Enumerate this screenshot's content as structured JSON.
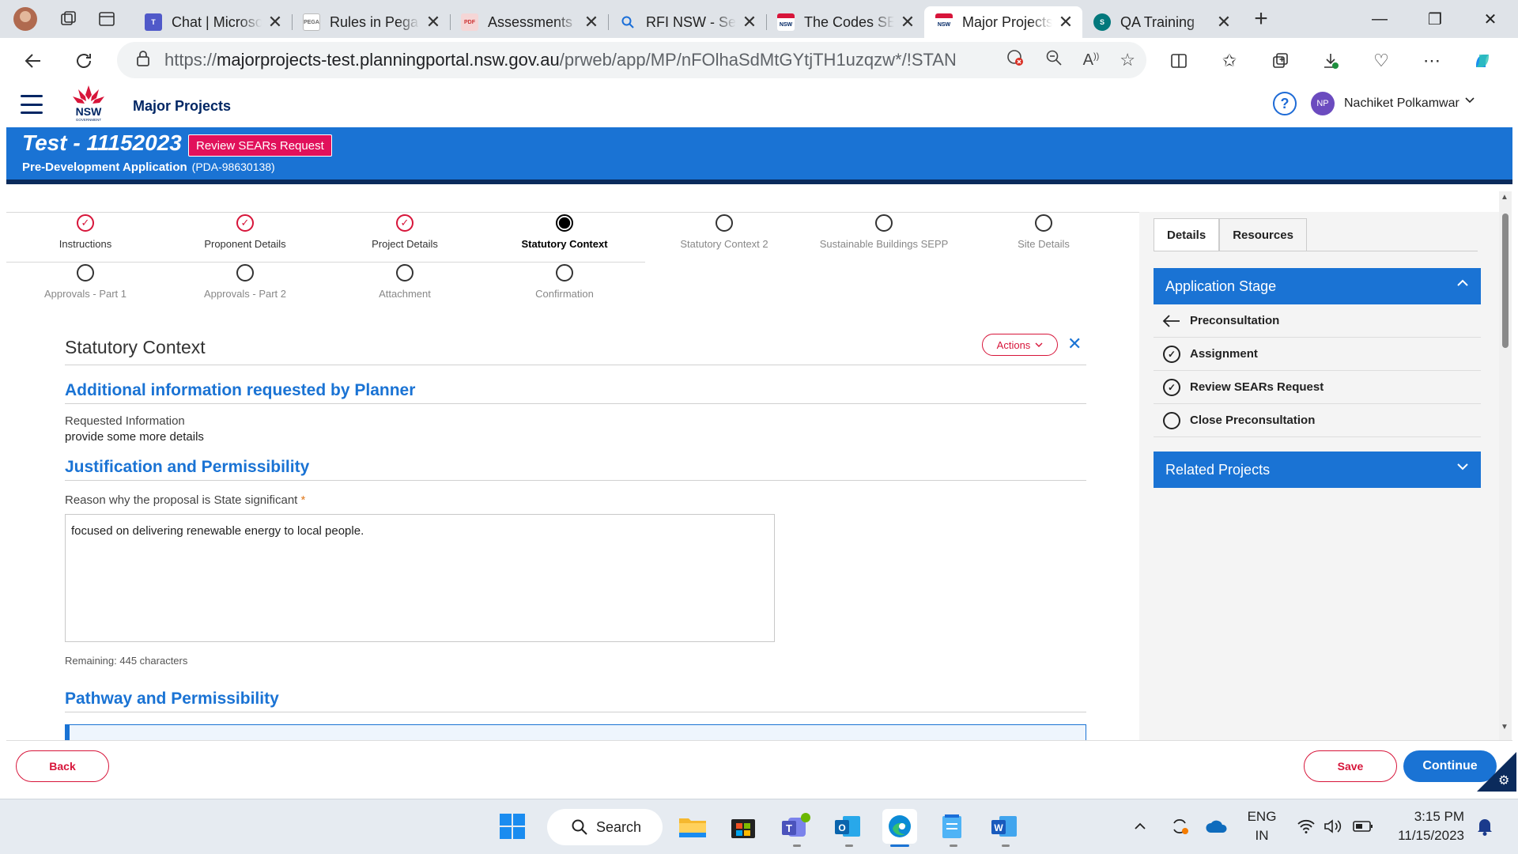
{
  "browser": {
    "tabs": [
      {
        "title": "Chat | Microsoft Teams",
        "icon": "teams-icon",
        "active": false
      },
      {
        "title": "Rules in Pega",
        "icon": "pega-icon",
        "active": false
      },
      {
        "title": "Assessments",
        "icon": "pdf-icon",
        "active": false
      },
      {
        "title": "RFI NSW - Search",
        "icon": "search-icon",
        "active": false
      },
      {
        "title": "The Codes SEPP",
        "icon": "nsw-icon",
        "active": false
      },
      {
        "title": "Major Projects",
        "icon": "nsw-icon",
        "active": true
      },
      {
        "title": "QA Training",
        "icon": "sharepoint-icon",
        "active": false
      }
    ],
    "url_prefix": "https://",
    "url_host": "majorprojects-test.planningportal.nsw.gov.au",
    "url_path": "/prweb/app/MP/nFOlhaSdMtGYtjTH1uzqzw*/!STAN..."
  },
  "app": {
    "name": "Major Projects",
    "logo_text": "NSW",
    "logo_sub": "GOVERNMENT",
    "user_initials": "NP",
    "user_name": "Nachiket Polkamwar",
    "help_glyph": "?"
  },
  "case": {
    "title": "Test - 11152023",
    "stage_badge": "Review SEARs Request",
    "type": "Pre-Development Application",
    "id": "(PDA-98630138)"
  },
  "steps": [
    {
      "label": "Instructions",
      "state": "done"
    },
    {
      "label": "Proponent Details",
      "state": "done"
    },
    {
      "label": "Project Details",
      "state": "done"
    },
    {
      "label": "Statutory Context",
      "state": "current"
    },
    {
      "label": "Statutory Context 2",
      "state": "todo"
    },
    {
      "label": "Sustainable Buildings SEPP",
      "state": "todo"
    },
    {
      "label": "Site Details",
      "state": "todo"
    },
    {
      "label": "Approvals - Part 1",
      "state": "todo"
    },
    {
      "label": "Approvals - Part 2",
      "state": "todo"
    },
    {
      "label": "Attachment",
      "state": "todo"
    },
    {
      "label": "Confirmation",
      "state": "todo"
    }
  ],
  "form": {
    "section_title": "Statutory Context",
    "actions_label": "Actions",
    "h_additional": "Additional information requested by Planner",
    "requested_label": "Requested Information",
    "requested_value": "provide some more details",
    "h_justification": "Justification and Permissibility",
    "reason_label": "Reason why the proposal is State significant",
    "required_mark": "*",
    "reason_value": "focused on delivering renewable energy to local people.",
    "remaining": "Remaining: 445 characters",
    "h_pathway": "Pathway and Permissibility"
  },
  "side_panel": {
    "tabs": [
      "Details",
      "Resources"
    ],
    "application_stage_title": "Application Stage",
    "stages": [
      {
        "label": "Preconsultation",
        "icon": "arrow-left-icon"
      },
      {
        "label": "Assignment",
        "icon": "check-circle-icon"
      },
      {
        "label": "Review SEARs Request",
        "icon": "check-circle-icon"
      },
      {
        "label": "Close Preconsultation",
        "icon": "empty-circle-icon"
      }
    ],
    "related_projects_title": "Related Projects"
  },
  "footer": {
    "back": "Back",
    "save": "Save",
    "continue": "Continue"
  },
  "taskbar": {
    "search": "Search",
    "lang_line1": "ENG",
    "lang_line2": "IN",
    "time": "3:15 PM",
    "date": "11/15/2023"
  },
  "colors": {
    "brand_blue": "#1a73d4",
    "nsw_red": "#d7153a",
    "badge_pink": "#e1115b",
    "navy": "#002664"
  }
}
